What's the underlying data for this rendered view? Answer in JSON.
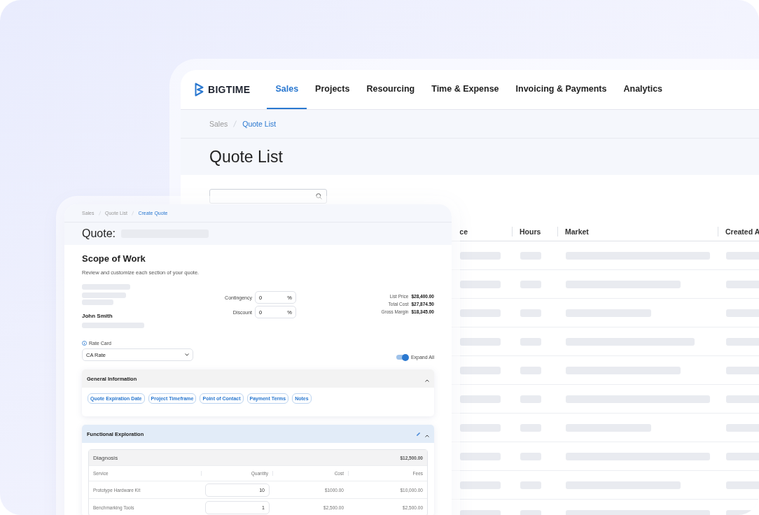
{
  "back_window": {
    "brand": "BIGTIME",
    "nav_tabs": [
      {
        "label": "Sales",
        "selected": true
      },
      {
        "label": "Projects",
        "selected": false
      },
      {
        "label": "Resourcing",
        "selected": false
      },
      {
        "label": "Time & Expense",
        "selected": false
      },
      {
        "label": "Invoicing & Payments",
        "selected": false
      },
      {
        "label": "Analytics",
        "selected": false
      }
    ],
    "breadcrumbs": [
      {
        "label": "Sales",
        "current": false
      },
      {
        "label": "Quote List",
        "current": true
      }
    ],
    "title": "Quote List",
    "table": {
      "columns": [
        "ce",
        "Hours",
        "Market",
        "Created A"
      ]
    }
  },
  "front_window": {
    "breadcrumbs": [
      {
        "label": "Sales",
        "current": false
      },
      {
        "label": "Quote List",
        "current": false
      },
      {
        "label": "Create Quote",
        "current": true
      }
    ],
    "title": "Quote:",
    "section_title": "Scope of Work",
    "section_subtitle": "Review and customize each section of your quote.",
    "client_name": "John Smith",
    "adjustments": [
      {
        "label": "Contingency",
        "value": "0",
        "unit": "%"
      },
      {
        "label": "Discount",
        "value": "0",
        "unit": "%"
      }
    ],
    "totals": [
      {
        "label": "List Price",
        "value": "$28,400.00"
      },
      {
        "label": "Total Cost",
        "value": "$27,874.50"
      },
      {
        "label": "Gross Margin",
        "value": "$18,345.00"
      }
    ],
    "rate_card": {
      "label": "Rate Card",
      "value": "CA Rate"
    },
    "expand_all": {
      "label": "Expand All",
      "on": true
    },
    "panels": [
      {
        "title": "General Information",
        "expanded": true,
        "highlighted": false,
        "editable": false,
        "chips": [
          "Quote Expiration Date",
          "Project Timeframe",
          "Point of Contact",
          "Payment Terms",
          "Notes"
        ]
      },
      {
        "title": "Functional Exploration",
        "expanded": true,
        "highlighted": true,
        "editable": true,
        "groups": [
          {
            "title": "Diagnosis",
            "total": "$12,500.00",
            "columns": [
              "Service",
              "Quantity",
              "Cost",
              "Fees"
            ],
            "rows": [
              {
                "service": "Prototype Hardware Kit",
                "quantity": "10",
                "cost": "$1000.00",
                "fees": "$10,000.00"
              },
              {
                "service": "Benchmarking Tools",
                "quantity": "1",
                "cost": "$2,500.00",
                "fees": "$2,500.00"
              }
            ]
          }
        ]
      }
    ]
  }
}
